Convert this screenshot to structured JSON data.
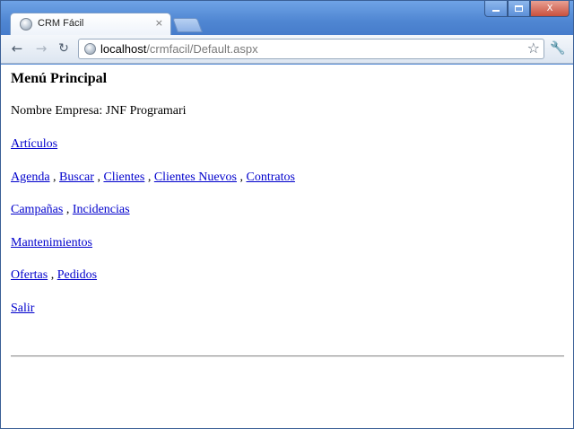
{
  "browser": {
    "tab": {
      "title": "CRM Fácil",
      "close": "×"
    },
    "window_buttons": {
      "close": "X"
    },
    "toolbar": {
      "back": "←",
      "forward": "→",
      "reload": "↻",
      "url_host": "localhost",
      "url_path": "/crmfacil/Default.aspx",
      "star": "☆",
      "wrench": "🔧"
    }
  },
  "page": {
    "title": "Menú Principal",
    "company_label": "Nombre Empresa:",
    "company_value": "JNF Programari",
    "separator": " , ",
    "rows": [
      {
        "links": [
          "Artículos"
        ]
      },
      {
        "links": [
          "Agenda",
          "Buscar",
          "Clientes",
          "Clientes Nuevos",
          "Contratos"
        ]
      },
      {
        "links": [
          "Campañas",
          "Incidencias"
        ]
      },
      {
        "links": [
          "Mantenimientos"
        ]
      },
      {
        "links": [
          "Ofertas",
          "Pedidos"
        ]
      },
      {
        "links": [
          "Salir"
        ]
      }
    ]
  }
}
